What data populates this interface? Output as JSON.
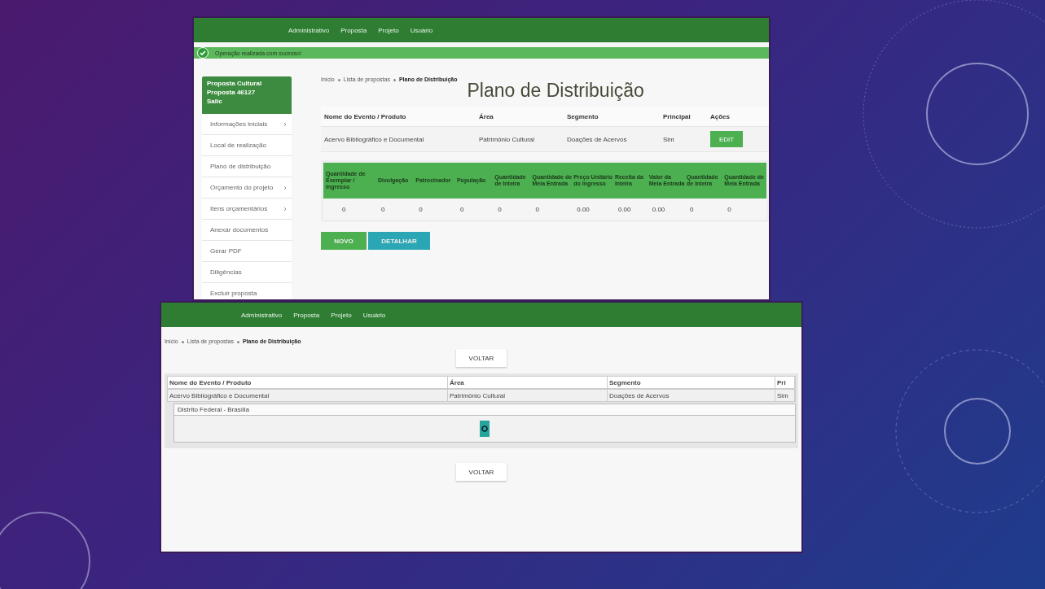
{
  "screenshot_top": {
    "nav": [
      "Administrativo",
      "Proposta",
      "Projeto",
      "Usuário"
    ],
    "alert": {
      "kind": "success",
      "text": "Operação realizada com sucesso!"
    },
    "sidebar": {
      "title": "Proposta Cultural",
      "subtitle": "Proposta 46127",
      "tag": "Salic",
      "items": [
        {
          "label": "Informações iniciais",
          "has_submenu": true
        },
        {
          "label": "Local de realização",
          "has_submenu": false
        },
        {
          "label": "Plano de distribuição",
          "has_submenu": false
        },
        {
          "label": "Orçamento do projeto",
          "has_submenu": true
        },
        {
          "label": "Itens orçamentários",
          "has_submenu": true
        },
        {
          "label": "Anexar documentos",
          "has_submenu": false
        },
        {
          "label": "Gerar PDF",
          "has_submenu": false
        },
        {
          "label": "Diligências",
          "has_submenu": false
        },
        {
          "label": "Excluir proposta",
          "has_submenu": false
        }
      ]
    },
    "breadcrumb": [
      "Início",
      "Lista de propostas",
      "Plano de Distribuição"
    ],
    "title": "Plano de Distribuição",
    "table": {
      "columns": [
        "Nome do Evento / Produto",
        "Área",
        "Segmento",
        "Principal",
        "Ações"
      ],
      "rows": [
        {
          "cells": [
            "Acervo Bibliográfico e Documental",
            "Patrimônio Cultural",
            "Doações de Acervos",
            "Sim"
          ],
          "action": "EDIT"
        }
      ]
    },
    "detail_table": {
      "columns": [
        "Quantidade de Exemplar / Ingresso",
        "Divulgação",
        "Patrocinador",
        "População",
        "Quantidade de Inteira",
        "Quantidade de Meia Entrada",
        "Preço Unitário do Ingresso",
        "Receita da Inteira",
        "Valor da Meia Entrada",
        "Quantidade de Inteira",
        "Quantidade de Meia Entrada"
      ],
      "rows": [
        [
          "0",
          "0",
          "0",
          "0",
          "0",
          "0",
          "0.00",
          "0.00",
          "0.00",
          "0",
          "0"
        ]
      ]
    },
    "buttons": [
      {
        "kind": "primary",
        "label": "NOVO"
      },
      {
        "kind": "secondary",
        "label": "DETALHAR"
      }
    ]
  },
  "screenshot_bottom": {
    "nav": [
      "Administrativo",
      "Proposta",
      "Projeto",
      "Usuário"
    ],
    "breadcrumb": [
      "Início",
      "Lista de propostas",
      "Plano de Distribuição"
    ],
    "back_button": "VOLTAR",
    "table": {
      "columns": [
        "Nome do Evento / Produto",
        "Área",
        "Segmento",
        "Pri"
      ],
      "rows": [
        {
          "cells": [
            "Acervo Bibliográfico e Documental",
            "Patrimônio Cultural",
            "Doações de Acervos",
            "Sim"
          ],
          "location": "Distrito Federal - Brasília"
        }
      ]
    },
    "back_button_bottom": "VOLTAR"
  }
}
